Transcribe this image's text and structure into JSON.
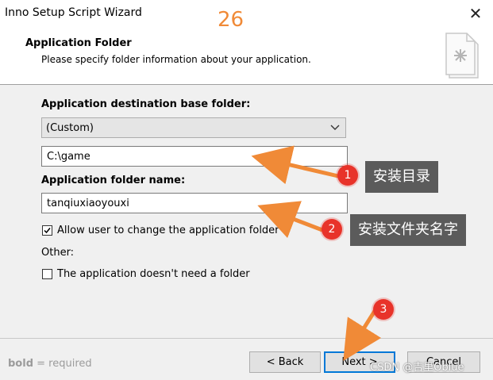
{
  "window": {
    "title": "Inno Setup Script Wizard",
    "close_icon": "close-icon"
  },
  "overlay_step": "26",
  "header": {
    "title": "Application Folder",
    "subtitle": "Please specify folder information about your application."
  },
  "form": {
    "base_folder_label": "Application destination base folder:",
    "base_folder_selected": "(Custom)",
    "custom_path_value": "C:\\game",
    "folder_name_label": "Application folder name:",
    "folder_name_value": "tanqiuxiaoyouxi",
    "allow_change_label": "Allow user to change the application folder",
    "allow_change_checked": true,
    "other_label": "Other:",
    "no_folder_label": "The application doesn't need a folder",
    "no_folder_checked": false
  },
  "footer": {
    "note_bold": "bold",
    "note_rest": " = required",
    "back_label": "< Back",
    "next_label": "Next >",
    "cancel_label": "Cancel"
  },
  "annotations": [
    {
      "number": "1",
      "text": "安装目录"
    },
    {
      "number": "2",
      "text": "安装文件夹名字"
    },
    {
      "number": "3",
      "text": ""
    }
  ],
  "watermark": "CSDN @吉里Oblue",
  "colors": {
    "accent": "#0078d7",
    "annotation_arrow": "#f08a37",
    "badge": "#e8332a",
    "callout_bg": "#5b5b5b"
  }
}
